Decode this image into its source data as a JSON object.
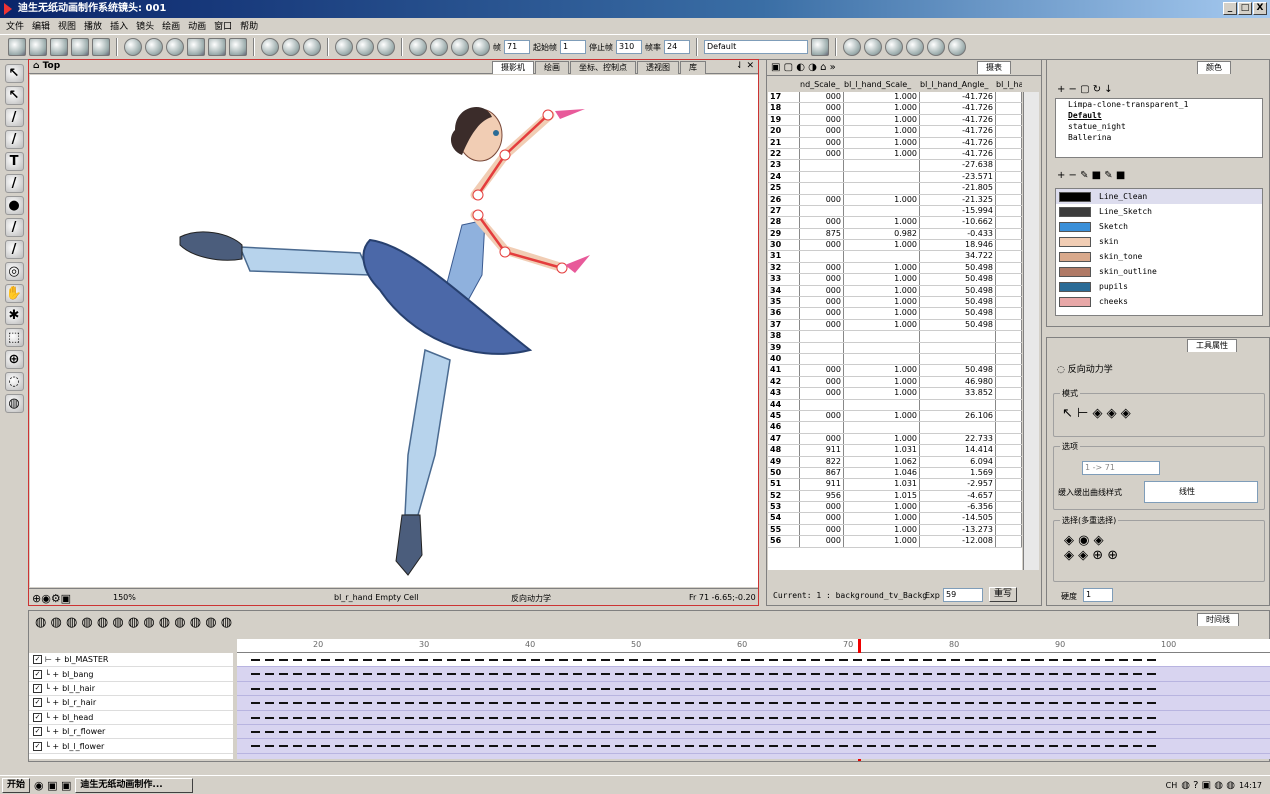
{
  "window": {
    "title": "迪生无纸动画制作系统镜头: 001",
    "buttons": [
      "_",
      "□",
      "X"
    ]
  },
  "menu": [
    "文件",
    "编辑",
    "视图",
    "播放",
    "插入",
    "镜头",
    "绘画",
    "动画",
    "窗口",
    "帮助"
  ],
  "toolbar": {
    "frame_label": "帧",
    "frame_value": "71",
    "start_label": "起始帧",
    "start_value": "1",
    "stop_label": "停止帧",
    "stop_value": "310",
    "rate_label": "帧率",
    "rate_value": "24",
    "scene_select": "Default"
  },
  "camera": {
    "title": "Top",
    "tabs": [
      "摄影机",
      "绘画",
      "坐标、控制点",
      "透视图",
      "库"
    ],
    "zoom": "150%",
    "status_cell": "bl_r_hand Empty Cell",
    "status_tool": "反向动力学",
    "status_frame": "Fr 71  -6.65;-0.20"
  },
  "xsheet": {
    "tab": "摄表",
    "columns": [
      "nd_Scale_",
      "bl_l_hand_Scale_",
      "bl_l_hand_Angle_",
      "bl_l_han"
    ],
    "rows": [
      [
        "17",
        "000",
        "1.000",
        "-41.726"
      ],
      [
        "18",
        "000",
        "1.000",
        "-41.726"
      ],
      [
        "19",
        "000",
        "1.000",
        "-41.726"
      ],
      [
        "20",
        "000",
        "1.000",
        "-41.726"
      ],
      [
        "21",
        "000",
        "1.000",
        "-41.726"
      ],
      [
        "22",
        "000",
        "1.000",
        "-41.726"
      ],
      [
        "23",
        "",
        "",
        "-27.638"
      ],
      [
        "24",
        "",
        "",
        "-23.571"
      ],
      [
        "25",
        "",
        "",
        "-21.805"
      ],
      [
        "26",
        "000",
        "1.000",
        "-21.325"
      ],
      [
        "27",
        "",
        "",
        "-15.994"
      ],
      [
        "28",
        "000",
        "1.000",
        "-10.662"
      ],
      [
        "29",
        "875",
        "0.982",
        "-0.433"
      ],
      [
        "30",
        "000",
        "1.000",
        "18.946"
      ],
      [
        "31",
        "",
        "",
        "34.722"
      ],
      [
        "32",
        "000",
        "1.000",
        "50.498"
      ],
      [
        "33",
        "000",
        "1.000",
        "50.498"
      ],
      [
        "34",
        "000",
        "1.000",
        "50.498"
      ],
      [
        "35",
        "000",
        "1.000",
        "50.498"
      ],
      [
        "36",
        "000",
        "1.000",
        "50.498"
      ],
      [
        "37",
        "000",
        "1.000",
        "50.498"
      ],
      [
        "38",
        "",
        "",
        ""
      ],
      [
        "39",
        "",
        "",
        ""
      ],
      [
        "40",
        "",
        "",
        ""
      ],
      [
        "41",
        "000",
        "1.000",
        "50.498"
      ],
      [
        "42",
        "000",
        "1.000",
        "46.980"
      ],
      [
        "43",
        "000",
        "1.000",
        "33.852"
      ],
      [
        "44",
        "",
        "",
        ""
      ],
      [
        "45",
        "000",
        "1.000",
        "26.106"
      ],
      [
        "46",
        "",
        "",
        ""
      ],
      [
        "47",
        "000",
        "1.000",
        "22.733"
      ],
      [
        "48",
        "911",
        "1.031",
        "14.414"
      ],
      [
        "49",
        "822",
        "1.062",
        "6.094"
      ],
      [
        "50",
        "867",
        "1.046",
        "1.569"
      ],
      [
        "51",
        "911",
        "1.031",
        "-2.957"
      ],
      [
        "52",
        "956",
        "1.015",
        "-4.657"
      ],
      [
        "53",
        "000",
        "1.000",
        "-6.356"
      ],
      [
        "54",
        "000",
        "1.000",
        "-14.505"
      ],
      [
        "55",
        "000",
        "1.000",
        "-13.273"
      ],
      [
        "56",
        "000",
        "1.000",
        "-12.008"
      ]
    ],
    "current": "Current:  1 : background_tv_Backg",
    "exp_label": "Exp",
    "exp_value": "59",
    "rewrite": "重写"
  },
  "color": {
    "tab": "颜色",
    "palettes": [
      "Limpa-clone-transparent_1",
      "Default",
      "statue_night",
      "Ballerina"
    ],
    "swatches": [
      {
        "name": "Line_Clean",
        "color": "#000000"
      },
      {
        "name": "Line_Sketch",
        "color": "#3c3c3c"
      },
      {
        "name": "Sketch",
        "color": "#3a8fd8"
      },
      {
        "name": "skin",
        "color": "#f1cdb4"
      },
      {
        "name": "skin_tone",
        "color": "#d9a98c"
      },
      {
        "name": "skin_outline",
        "color": "#b07a66"
      },
      {
        "name": "pupils",
        "color": "#2a6b96"
      },
      {
        "name": "cheeks",
        "color": "#e8a8a8"
      }
    ]
  },
  "tool": {
    "tab": "工具属性",
    "name": "反向动力学",
    "mode": "模式",
    "select": "选项",
    "range": "1 -> 71",
    "curve_label": "缓入缓出曲线样式",
    "curve_value": "线性",
    "multi": "选择(多重选择)",
    "hard": "硬度",
    "hard_value": "1"
  },
  "timeline": {
    "tab": "时间线",
    "ticks": [
      "20",
      "30",
      "40",
      "50",
      "60",
      "70",
      "80",
      "90",
      "100"
    ],
    "layers": [
      "bl_MASTER",
      "bl_bang",
      "bl_l_hair",
      "bl_r_hair",
      "bl_head",
      "bl_r_flower",
      "bl_l_flower"
    ]
  },
  "taskbar": {
    "start": "开始",
    "task": "迪生无纸动画制作...",
    "lang": "CH",
    "time": "14:17"
  }
}
